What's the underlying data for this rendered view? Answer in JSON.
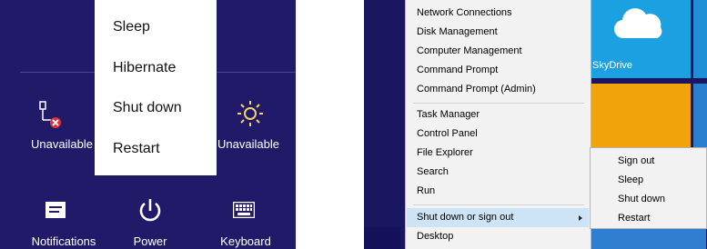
{
  "left_panel": {
    "power_menu": {
      "items": [
        "Sleep",
        "Hibernate",
        "Shut down",
        "Restart"
      ]
    },
    "tiles": {
      "network": {
        "label": "Unavailable",
        "icon": "network-unavailable-icon"
      },
      "brightness": {
        "label": "Unavailable",
        "icon": "brightness-icon"
      },
      "notifications": {
        "label": "Notifications",
        "icon": "notifications-icon"
      },
      "power": {
        "label": "Power",
        "icon": "power-icon"
      },
      "keyboard": {
        "label": "Keyboard",
        "icon": "keyboard-icon"
      }
    },
    "background_color": "#211a69"
  },
  "right_panel": {
    "winx_menu": {
      "items": [
        "Network Connections",
        "Disk Management",
        "Computer Management",
        "Command Prompt",
        "Command Prompt (Admin)",
        "Task Manager",
        "Control Panel",
        "File Explorer",
        "Search",
        "Run",
        "Shut down or sign out",
        "Desktop"
      ],
      "highlighted": "Shut down or sign out"
    },
    "submenu": {
      "items": [
        "Sign out",
        "Sleep",
        "Shut down",
        "Restart"
      ]
    },
    "start_tiles": {
      "skydrive_label": "SkyDrive"
    },
    "colors": {
      "skydrive_tile": "#1ba1e2",
      "yellow_tile": "#f0a30a",
      "highlight": "#cde4f7"
    }
  }
}
